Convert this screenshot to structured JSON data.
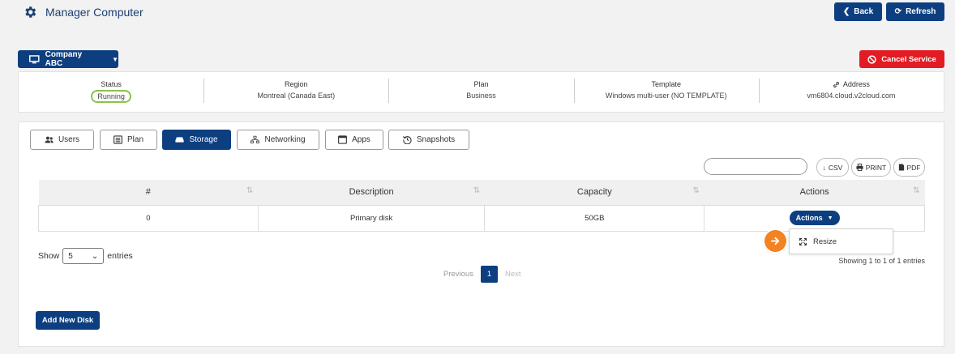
{
  "header": {
    "title": "Manager Computer",
    "back_label": "Back",
    "refresh_label": "Refresh"
  },
  "company": {
    "label": "Company ABC"
  },
  "cancel": {
    "label": "Cancel Service"
  },
  "info": {
    "status_label": "Status",
    "status_value": "Running",
    "region_label": "Region",
    "region_value": "Montreal (Canada East)",
    "plan_label": "Plan",
    "plan_value": "Business",
    "template_label": "Template",
    "template_value": "Windows multi-user (NO TEMPLATE)",
    "address_label": "Address",
    "address_value": "vm6804.cloud.v2cloud.com"
  },
  "tabs": [
    {
      "label": "Users",
      "icon": "users-icon"
    },
    {
      "label": "Plan",
      "icon": "list-icon"
    },
    {
      "label": "Storage",
      "icon": "hard-drive-icon",
      "active": true
    },
    {
      "label": "Networking",
      "icon": "network-icon"
    },
    {
      "label": "Apps",
      "icon": "window-icon"
    },
    {
      "label": "Snapshots",
      "icon": "history-icon"
    }
  ],
  "export": {
    "csv": "CSV",
    "print": "PRINT",
    "pdf": "PDF"
  },
  "table": {
    "columns": [
      "#",
      "Description",
      "Capacity",
      "Actions"
    ],
    "rows": [
      {
        "num": "0",
        "description": "Primary disk",
        "capacity": "50GB",
        "action_label": "Actions"
      }
    ]
  },
  "dropdown": {
    "items": [
      "Resize"
    ]
  },
  "pagination": {
    "show_label": "Show",
    "entries_value": "5",
    "entries_label": "entries",
    "info": "Showing 1 to 1 of 1 entries",
    "previous": "Previous",
    "current": "1",
    "next": "Next"
  },
  "add_disk": {
    "label": "Add New Disk"
  },
  "colors": {
    "primary": "#0d3f80",
    "danger": "#e31b23",
    "status": "#8bc34a",
    "pointer": "#f38220"
  }
}
